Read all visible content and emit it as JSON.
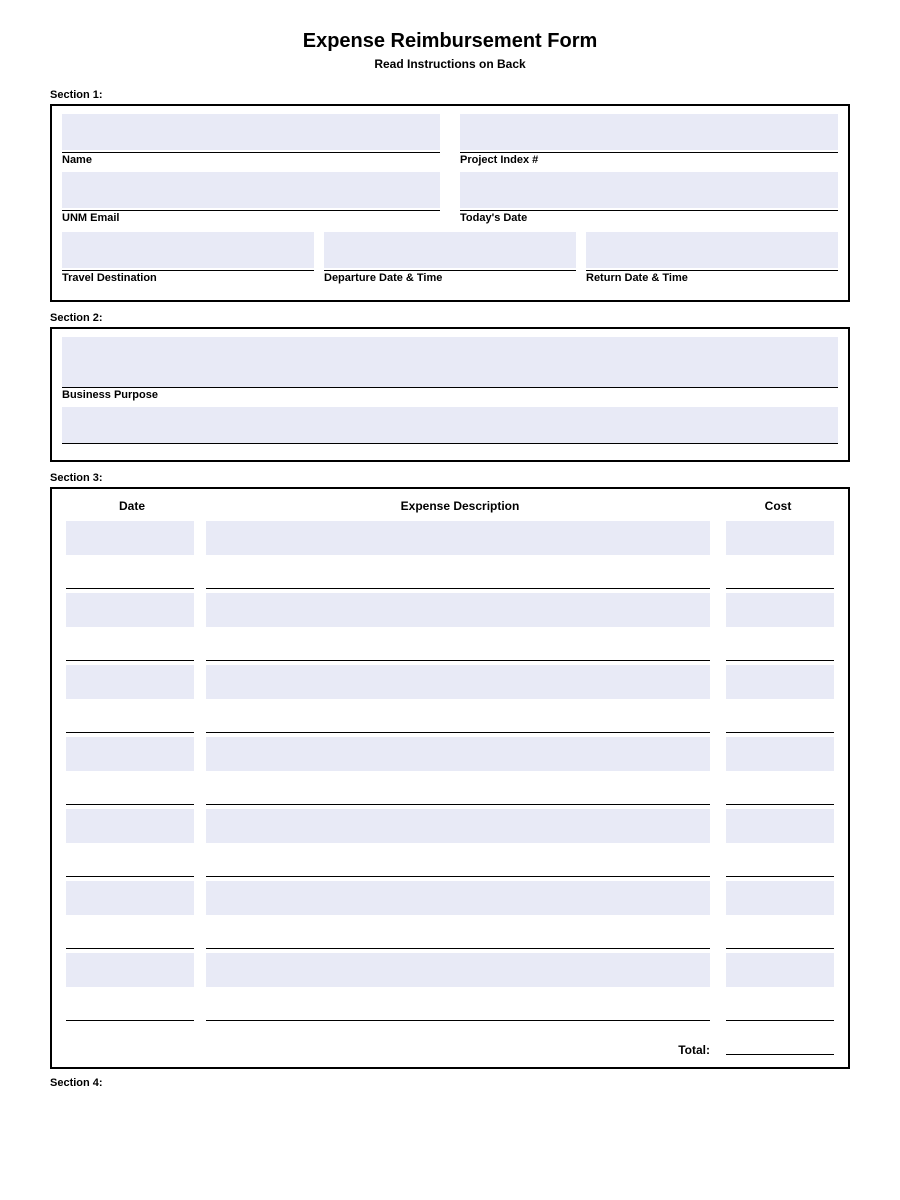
{
  "header": {
    "title": "Expense Reimbursement Form",
    "subtitle": "Read Instructions on Back"
  },
  "section1": {
    "label": "Section 1:",
    "fields": {
      "name_label": "Name",
      "project_index_label": "Project Index #",
      "unm_email_label": "UNM Email",
      "todays_date_label": "Today's Date",
      "travel_destination_label": "Travel Destination",
      "departure_label": "Departure Date & Time",
      "return_label": "Return Date & Time"
    }
  },
  "section2": {
    "label": "Section 2:",
    "fields": {
      "business_purpose_label": "Business Purpose"
    }
  },
  "section3": {
    "label": "Section 3:",
    "headers": {
      "date": "Date",
      "description": "Expense Description",
      "cost": "Cost"
    },
    "total_label": "Total:",
    "rows": 7
  },
  "section4": {
    "label": "Section 4:"
  }
}
